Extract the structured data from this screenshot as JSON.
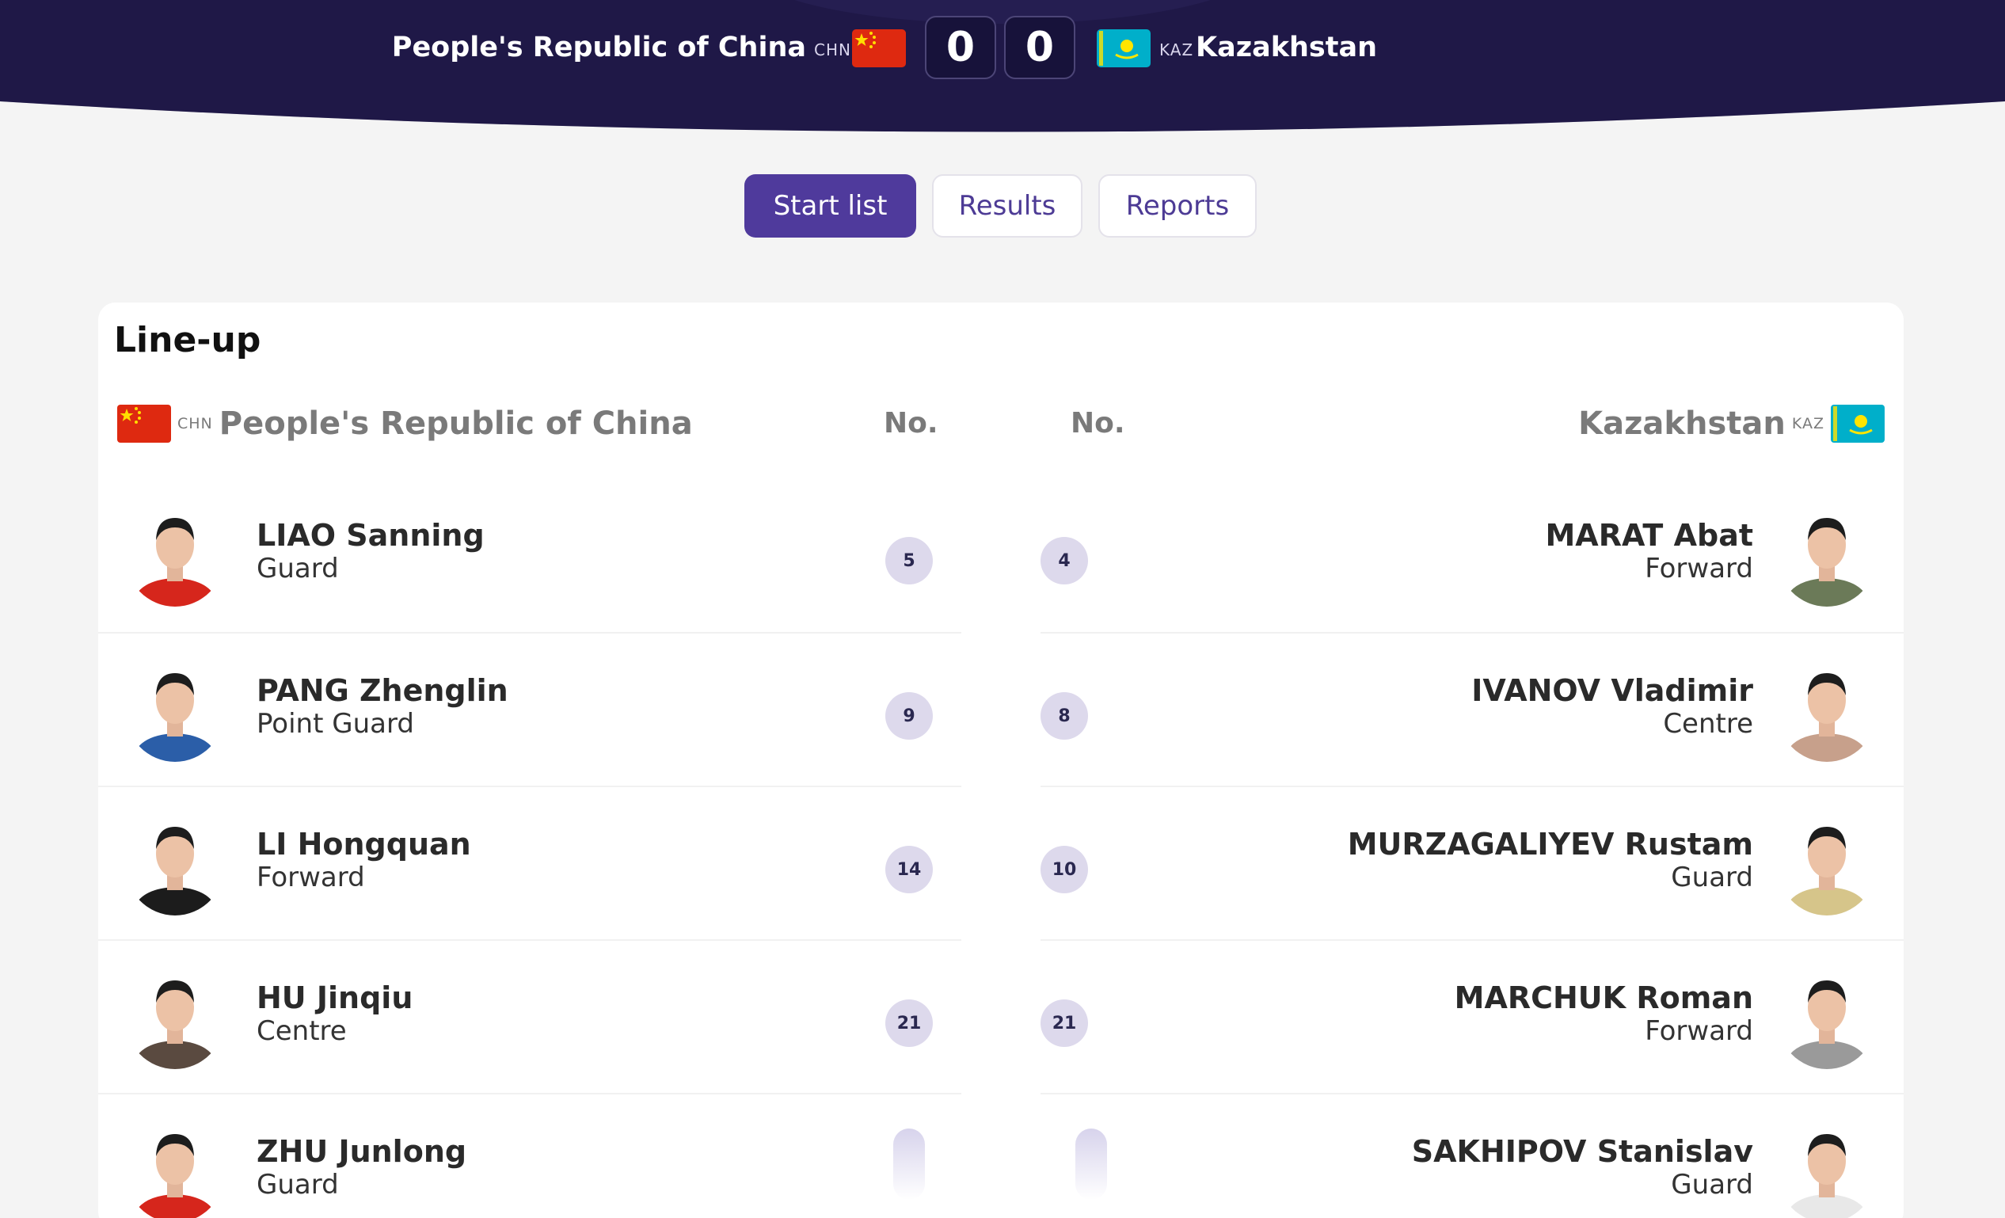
{
  "match": {
    "home": {
      "name": "People's Republic of China",
      "code": "CHN",
      "score": "0"
    },
    "away": {
      "name": "Kazakhstan",
      "code": "KAZ",
      "score": "0"
    }
  },
  "tabs": [
    {
      "label": "Start list",
      "active": true
    },
    {
      "label": "Results",
      "active": false
    },
    {
      "label": "Reports",
      "active": false
    }
  ],
  "lineup": {
    "title": "Line-up",
    "number_header": "No.",
    "home_players": [
      {
        "name": "LIAO Sanning",
        "position": "Guard",
        "number": "5",
        "shirt": "#d6261c"
      },
      {
        "name": "PANG Zhenglin",
        "position": "Point Guard",
        "number": "9",
        "shirt": "#2b5ea8"
      },
      {
        "name": "LI Hongquan",
        "position": "Forward",
        "number": "14",
        "shirt": "#1c1c1c"
      },
      {
        "name": "HU Jinqiu",
        "position": "Centre",
        "number": "21",
        "shirt": "#5a4a40"
      },
      {
        "name": "ZHU Junlong",
        "position": "Guard",
        "number": "",
        "shirt": "#d6261c"
      }
    ],
    "away_players": [
      {
        "name": "MARAT Abat",
        "position": "Forward",
        "number": "4",
        "shirt": "#6b7a58"
      },
      {
        "name": "IVANOV Vladimir",
        "position": "Centre",
        "number": "8",
        "shirt": "#c7a08b"
      },
      {
        "name": "MURZAGALIYEV Rustam",
        "position": "Guard",
        "number": "10",
        "shirt": "#d6c58a"
      },
      {
        "name": "MARCHUK Roman",
        "position": "Forward",
        "number": "21",
        "shirt": "#9a9a9a"
      },
      {
        "name": "SAKHIPOV Stanislav",
        "position": "Guard",
        "number": "",
        "shirt": "#e8e8e8"
      }
    ]
  },
  "colors": {
    "header_bg": "#1c1640",
    "accent": "#4f3a9c",
    "badge_bg": "#ddd9ec"
  }
}
